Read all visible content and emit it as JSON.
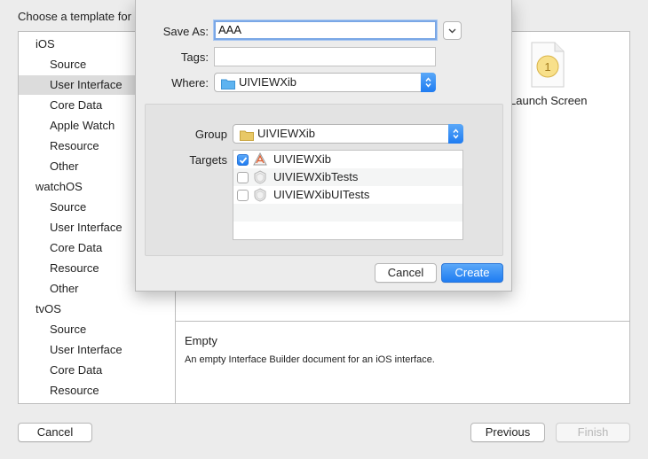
{
  "chooser": {
    "heading": "Choose a template for",
    "sidebar": [
      {
        "label": "iOS",
        "type": "section"
      },
      {
        "label": "Source",
        "type": "item"
      },
      {
        "label": "User Interface",
        "type": "item",
        "selected": true
      },
      {
        "label": "Core Data",
        "type": "item"
      },
      {
        "label": "Apple Watch",
        "type": "item"
      },
      {
        "label": "Resource",
        "type": "item"
      },
      {
        "label": "Other",
        "type": "item"
      },
      {
        "label": "watchOS",
        "type": "section"
      },
      {
        "label": "Source",
        "type": "item"
      },
      {
        "label": "User Interface",
        "type": "item"
      },
      {
        "label": "Core Data",
        "type": "item"
      },
      {
        "label": "Resource",
        "type": "item"
      },
      {
        "label": "Other",
        "type": "item"
      },
      {
        "label": "tvOS",
        "type": "section"
      },
      {
        "label": "Source",
        "type": "item"
      },
      {
        "label": "User Interface",
        "type": "item"
      },
      {
        "label": "Core Data",
        "type": "item"
      },
      {
        "label": "Resource",
        "type": "item"
      }
    ],
    "template_label": "Launch Screen",
    "template_icon": "launch-screen-file-icon",
    "template_icon_number": "1",
    "description_title": "Empty",
    "description_text": "An empty Interface Builder document for an iOS interface.",
    "cancel_label": "Cancel",
    "previous_label": "Previous",
    "finish_label": "Finish"
  },
  "sheet": {
    "save_as_label": "Save As:",
    "save_as_value": "AAA",
    "tags_label": "Tags:",
    "tags_value": "",
    "where_label": "Where:",
    "where_value": "UIVIEWXib",
    "group_label": "Group",
    "group_value": "UIVIEWXib",
    "targets_label": "Targets",
    "targets": [
      {
        "name": "UIVIEWXib",
        "checked": true,
        "icon": "app-target-icon"
      },
      {
        "name": "UIVIEWXibTests",
        "checked": false,
        "icon": "test-target-icon"
      },
      {
        "name": "UIVIEWXibUITests",
        "checked": false,
        "icon": "test-target-icon"
      }
    ],
    "cancel_label": "Cancel",
    "create_label": "Create"
  },
  "colors": {
    "accent": "#1f7cf2",
    "folder": "#5db3f0",
    "group_folder": "#e8c866"
  }
}
